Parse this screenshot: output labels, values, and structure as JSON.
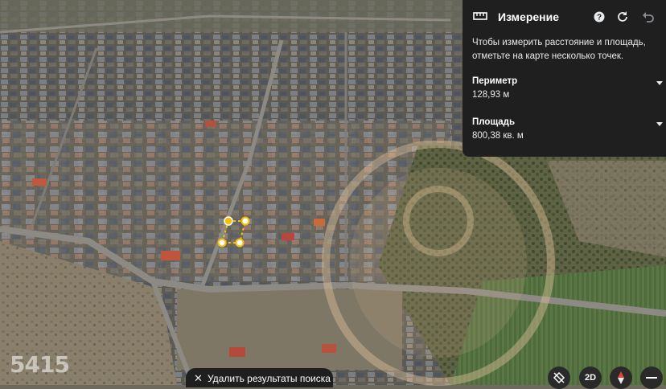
{
  "panel": {
    "title": "Измерение",
    "instructions": "Чтобы измерить расстояние и площадь, отметьте на карте несколько точек.",
    "perimeter_label": "Периметр",
    "perimeter_value": "128,93 м",
    "area_label": "Площадь",
    "area_value": "800,38 кв. м"
  },
  "search": {
    "clear_label": "Удалить результаты поиска"
  },
  "controls": {
    "mode_2d": "2D"
  },
  "watermark": {
    "number": "5415"
  },
  "colors": {
    "panel_bg": "#1f1f1f",
    "measure_point": "#fbbc04"
  }
}
